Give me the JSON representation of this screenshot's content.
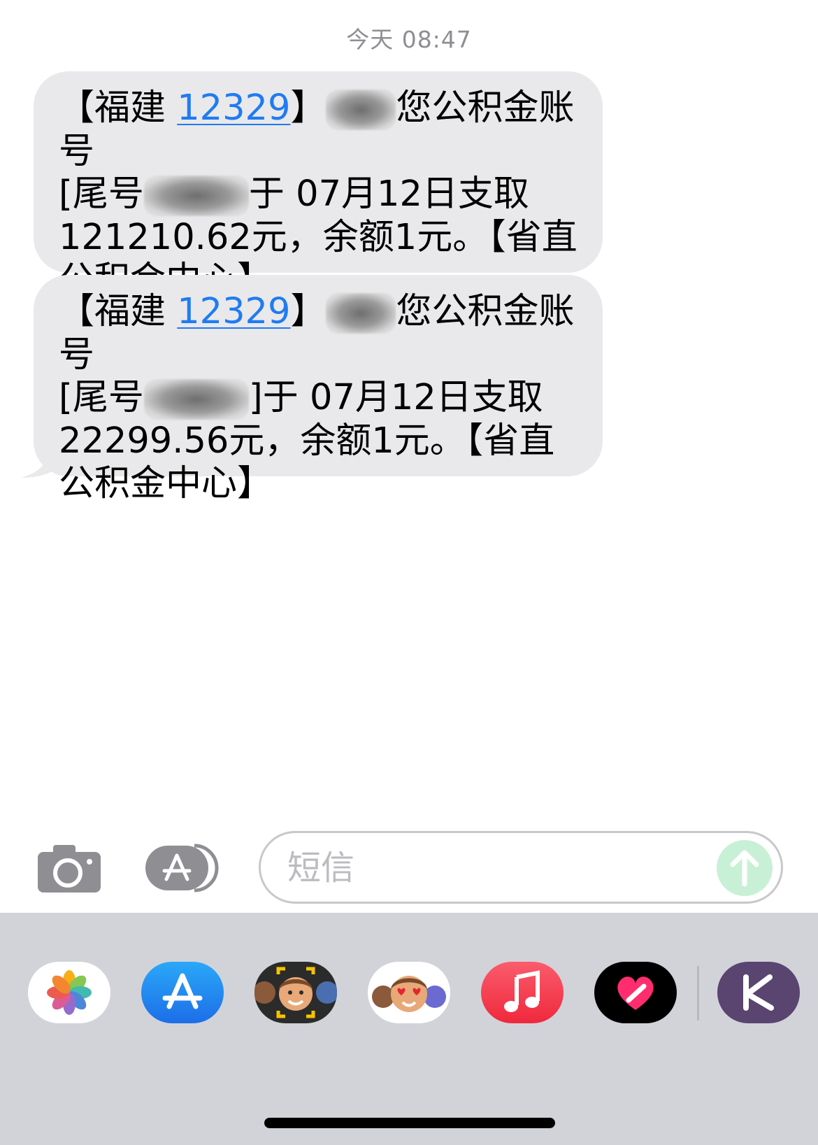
{
  "timestamp": "今天 08:47",
  "messages": [
    {
      "prefix": "【福建 ",
      "sender_number": "12329",
      "after_number": "】",
      "account_text": "您公积金账号",
      "line2_prefix": "[尾号",
      "line2_suffix": "于 07月12日支取",
      "amount_line": "121210.62元，余额1元。【省直",
      "closing": "公积金中心】"
    },
    {
      "prefix": "【福建 ",
      "sender_number": "12329",
      "after_number": "】",
      "account_text": "您公积金账号",
      "line2_prefix": "[尾号",
      "line2_suffix": "]于 07月12日支取",
      "amount_line": "22299.56元，余额1元。【省直",
      "closing": "公积金中心】"
    }
  ],
  "composer": {
    "placeholder": "短信",
    "value": ""
  },
  "icons": {
    "camera": "camera-icon",
    "apps": "app-store-icon",
    "send": "send-arrow-icon"
  },
  "drawer_apps": [
    {
      "name": "Photos"
    },
    {
      "name": "App Store"
    },
    {
      "name": "Memoji"
    },
    {
      "name": "Memoji Stickers"
    },
    {
      "name": "Music"
    },
    {
      "name": "Digital Touch"
    },
    {
      "name": "Keep"
    }
  ],
  "colors": {
    "link": "#1f7bf2",
    "bubble": "#e9e9eb",
    "drawer": "#d1d3d9",
    "send": "#c8f0d6"
  }
}
